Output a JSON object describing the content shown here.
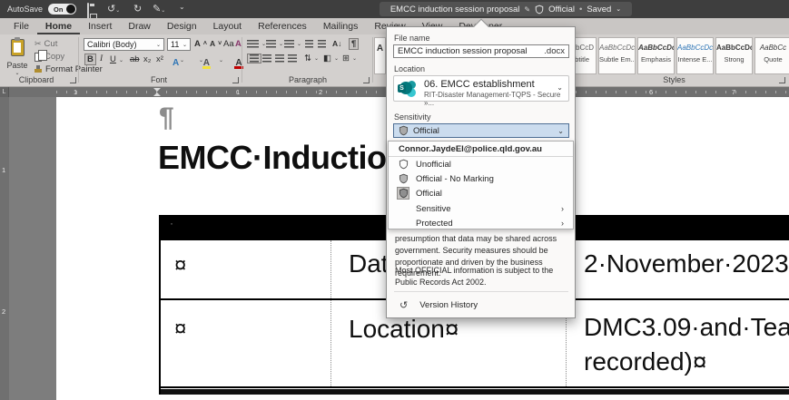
{
  "titlebar": {
    "autosave_label": "AutoSave",
    "autosave_state": "On",
    "title": "EMCC induction session proposal",
    "badge": "Official",
    "dot": "•",
    "saved": "Saved",
    "chevron": "⌄",
    "undo_glyph": "↺",
    "redo_glyph": "↻",
    "pen_glyph": "✎",
    "more_glyph": "⌄"
  },
  "ribbon": {
    "tabs": [
      "File",
      "Home",
      "Insert",
      "Draw",
      "Design",
      "Layout",
      "References",
      "Mailings",
      "Review",
      "View",
      "Developer"
    ],
    "clipboard": {
      "title": "Clipboard",
      "paste": "Paste",
      "cut": "Cut",
      "copy": "Copy",
      "format_painter": "Format Painter",
      "cut_glyph": "✂"
    },
    "font": {
      "title": "Font",
      "family": "Calibri (Body)",
      "size": "11",
      "grow": "A",
      "grow_caret": "˄",
      "shrink": "A",
      "shrink_caret": "˅",
      "case": "Aa",
      "clear": "A",
      "bold": "B",
      "italic": "I",
      "underline": "U",
      "strike": "ab",
      "subscript": "x₂",
      "superscript": "x²",
      "effects": "A",
      "color": "A"
    },
    "paragraph": {
      "title": "Paragraph",
      "sort": "A↓",
      "pilcrow": "¶",
      "spacing": "⇅",
      "shading": "◧",
      "borders": "⊞"
    },
    "styles": {
      "title": "Styles",
      "partial_sample": "A",
      "tiles": [
        {
          "sample": "AaBbCcD",
          "label": "Subtitle"
        },
        {
          "sample": "AaBbCcDc",
          "label": "Subtle Em..."
        },
        {
          "sample": "AaBbCcDc",
          "label": "Emphasis"
        },
        {
          "sample": "AaBbCcDc",
          "label": "Intense E..."
        },
        {
          "sample": "AaBbCcDc",
          "label": "Strong"
        },
        {
          "sample": "AaBbCc",
          "label": "Quote"
        }
      ]
    }
  },
  "ruler": {
    "tab_selector": "L",
    "h": [
      "1",
      "1",
      "2",
      "6",
      "7"
    ],
    "v": [
      "1",
      "2"
    ]
  },
  "panel": {
    "file_name_label": "File name",
    "file_name_value": "EMCC induction session proposal",
    "file_extension": ".docx",
    "location_label": "Location",
    "location_title": "06. EMCC establishment",
    "location_path": "RIT-Disaster Management-TQPS - Secure »...",
    "chevron": "⌄",
    "sensitivity_label": "Sensitivity",
    "sensitivity_value": "Official",
    "menu": {
      "email": "Connor.JaydeEl@police.qld.gov.au",
      "items": [
        {
          "label": "Unofficial"
        },
        {
          "label": "Official - No Marking"
        },
        {
          "label": "Official"
        },
        {
          "label": "Sensitive",
          "chevron": "›"
        },
        {
          "label": "Protected",
          "chevron": "›"
        }
      ]
    },
    "description_1": "presumption that data may be shared across government. Security measures should be proportionate and driven by the business requirement.",
    "description_2": "Most OFFICIAL information is subject to the Public Records Act 2002.",
    "version_history": "Version History",
    "history_glyph": "↺"
  },
  "document": {
    "pilcrow": "¶",
    "heading": "EMCC·Induction·S",
    "table": {
      "header_dot": "·",
      "rows": [
        {
          "c1": "¤",
          "c2": "Date",
          "c3": "2·November·2023"
        },
        {
          "c1": "¤",
          "c2": "Location¤",
          "c3_line1": "DMC3.09·and·Tea",
          "c3_line2": "recorded)¤"
        }
      ]
    }
  }
}
